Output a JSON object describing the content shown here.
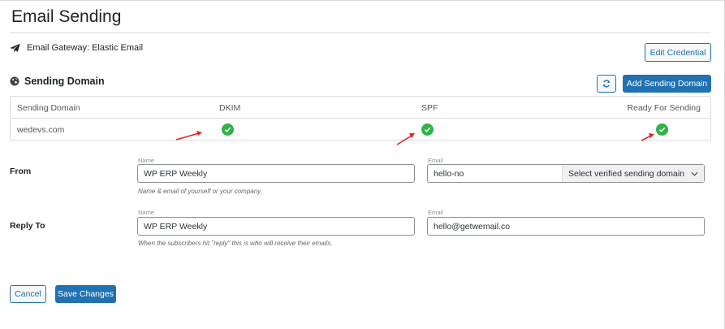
{
  "page": {
    "title": "Email Sending"
  },
  "gateway": {
    "icon": "paper-plane-icon",
    "label": "Email Gateway: Elastic Email",
    "edit_credential_label": "Edit Credential"
  },
  "sending_domain": {
    "icon": "globe-icon",
    "heading": "Sending Domain",
    "refresh_icon": "refresh-icon",
    "add_label": "Add Sending Domain",
    "columns": [
      "Sending Domain",
      "DKIM",
      "SPF",
      "Ready For Sending"
    ],
    "rows": [
      {
        "domain": "wedevs.com",
        "dkim": true,
        "spf": true,
        "ready": true
      }
    ]
  },
  "form": {
    "from": {
      "label": "From",
      "name_caption": "Name",
      "name_value": "WP ERP Weekly",
      "email_caption": "Email",
      "email_value": "hello-no",
      "domain_select": "Select verified sending domain",
      "help": "Name & email of yourself or your company."
    },
    "reply_to": {
      "label": "Reply To",
      "name_caption": "Name",
      "name_value": "WP ERP Weekly",
      "email_caption": "Email",
      "email_value": "hello@getwemail.co",
      "help": "When the subscribers hit \"reply\" this is who will receive their emails."
    }
  },
  "actions": {
    "cancel_label": "Cancel",
    "save_label": "Save Changes"
  },
  "colors": {
    "primary": "#2271b1",
    "success": "#2fb344",
    "annotation_arrow": "#e02424"
  }
}
